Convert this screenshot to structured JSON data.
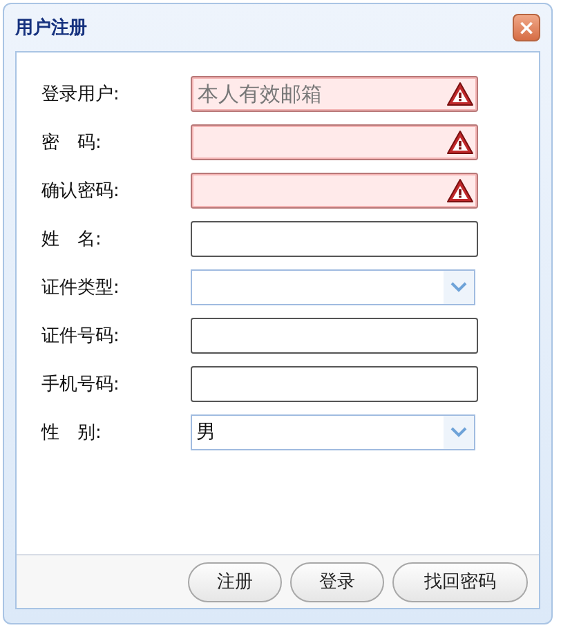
{
  "window": {
    "title": "用户注册",
    "close": "×"
  },
  "fields": [
    {
      "label": "登录用户:",
      "kind": "text",
      "invalid": true,
      "placeholder": "本人有效邮箱"
    },
    {
      "label": "密　码:",
      "kind": "text",
      "invalid": true
    },
    {
      "label": "确认密码:",
      "kind": "text",
      "invalid": true
    },
    {
      "label": "姓　名:",
      "kind": "text",
      "invalid": false
    },
    {
      "label": "证件类型:",
      "kind": "select"
    },
    {
      "label": "证件号码:",
      "kind": "text",
      "invalid": false
    },
    {
      "label": "手机号码:",
      "kind": "text",
      "invalid": false
    },
    {
      "label": "性　别:",
      "kind": "select",
      "value": "男"
    }
  ],
  "buttons": [
    "注册",
    "登录",
    "找回密码"
  ]
}
